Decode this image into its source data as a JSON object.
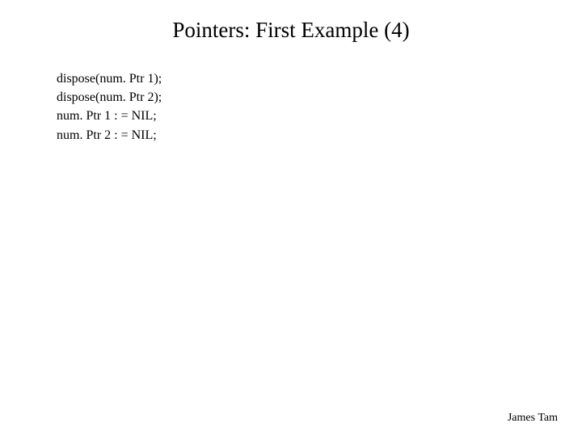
{
  "title": "Pointers: First Example (4)",
  "code": {
    "lines": [
      "dispose(num. Ptr 1);",
      "dispose(num. Ptr 2);",
      "num. Ptr 1 : = NIL;",
      "num. Ptr 2 : = NIL;"
    ]
  },
  "footer": "James Tam"
}
